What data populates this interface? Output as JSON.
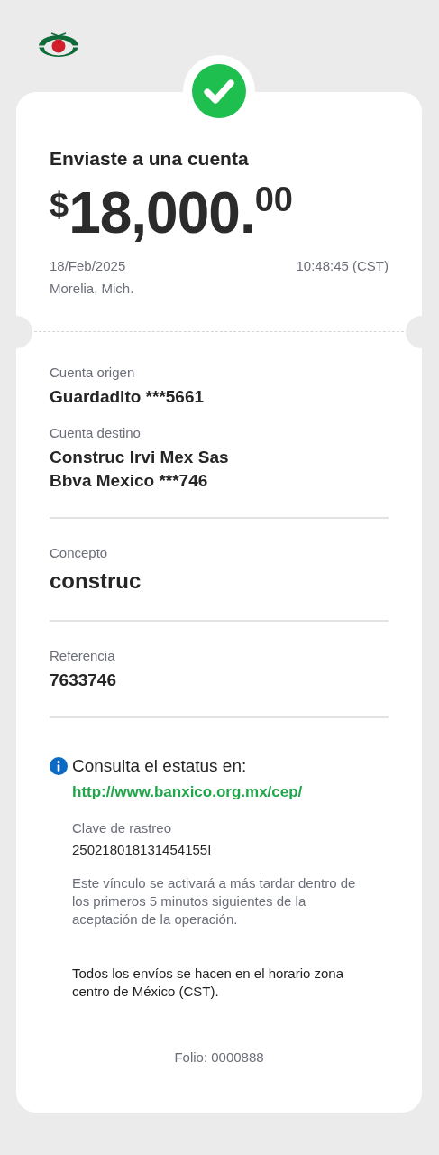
{
  "receipt": {
    "completed": true,
    "title": "Enviaste a una cuenta",
    "amount": {
      "currency": "$",
      "whole": "18,000.",
      "cents": "00"
    },
    "date": "18/Feb/2025",
    "time": "10:48:45 (CST)",
    "location": "Morelia, Mich.",
    "sections": [
      [
        {
          "label": "Cuenta origen",
          "kind": "standard",
          "lines": [
            "Guardadito ***5661"
          ]
        },
        {
          "label": "Cuenta destino",
          "kind": "standard",
          "lines": [
            "Construc Irvi Mex Sas",
            "Bbva Mexico ***746"
          ]
        }
      ],
      [
        {
          "label": "Concepto",
          "kind": "large",
          "lines": [
            "construc"
          ]
        }
      ],
      [
        {
          "label": "Referencia",
          "kind": "standard",
          "lines": [
            "7633746"
          ]
        }
      ]
    ],
    "info": {
      "title": "Consulta el estatus en:",
      "link": "http://www.banxico.org.mx/cep/",
      "tracking_label": "Clave de rastreo",
      "tracking_value": "250218018131454155I",
      "note": "Este vínculo se activará a más tardar dentro de los primeros 5 minutos siguientes de la aceptación de la operación."
    },
    "schedule_note": "Todos los envíos se hacen en el horario zona centro de México (CST).",
    "folio": "Folio: 0000888"
  }
}
